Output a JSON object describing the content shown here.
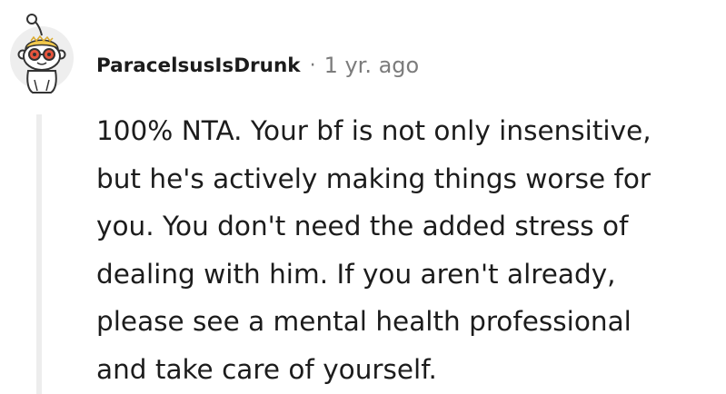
{
  "comment": {
    "author": "ParacelsusIsDrunk",
    "separator": "·",
    "timestamp": "1 yr. ago",
    "lines": [
      "100% NTA. Your bf is not only insensitive,",
      "but he's actively making things worse for",
      "you. You don't need the added stress of",
      "dealing with him. If you aren't already,",
      "please see a mental health professional",
      "and take care of yourself."
    ]
  },
  "avatar": {
    "icon": "snoo-avatar-icon",
    "colors": {
      "background": "#eeeeee",
      "hair": "#f2c94c",
      "glasses": "#e8553d",
      "outline": "#333333"
    }
  },
  "colors": {
    "text": "#1c1c1c",
    "meta": "#7c7c7c",
    "thread_line": "#ededed"
  }
}
